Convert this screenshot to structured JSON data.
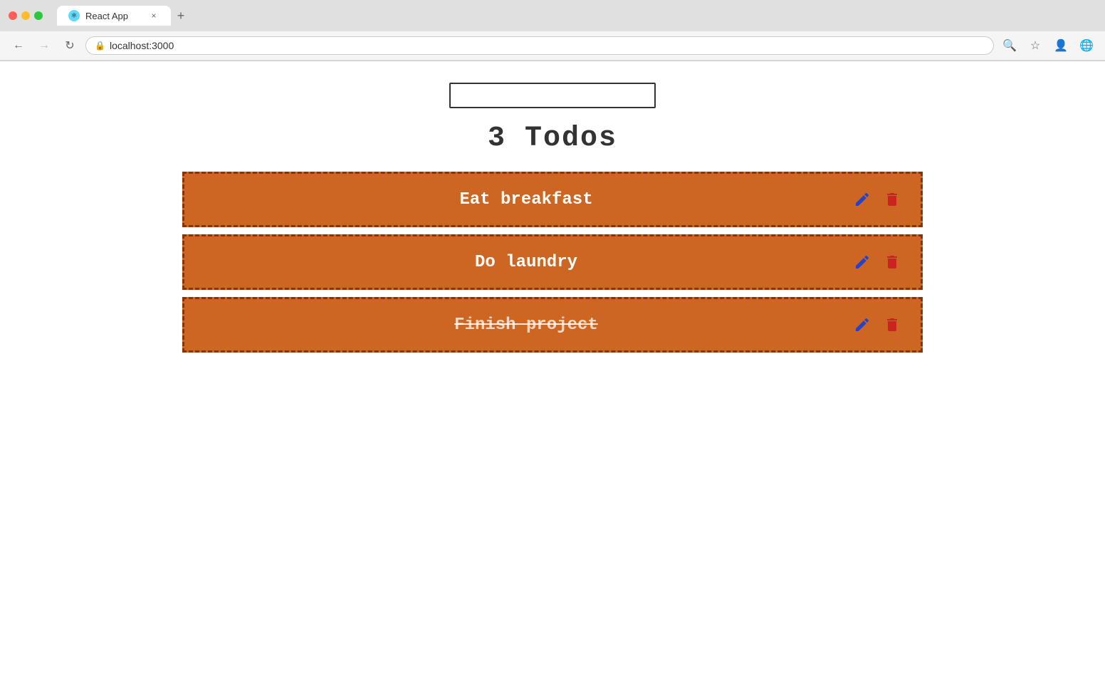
{
  "browser": {
    "tab_title": "React App",
    "address": "localhost:3000",
    "new_tab_label": "+",
    "close_tab_label": "×"
  },
  "app": {
    "input_placeholder": "",
    "todo_count_label": "3  Todos",
    "todos": [
      {
        "id": 1,
        "text": "Eat breakfast",
        "completed": false
      },
      {
        "id": 2,
        "text": "Do laundry",
        "completed": false
      },
      {
        "id": 3,
        "text": "Finish project",
        "completed": true
      }
    ]
  },
  "colors": {
    "todo_bg": "#cc6622",
    "todo_border": "#8b3300",
    "edit_icon": "#2244cc",
    "delete_icon": "#cc2222"
  }
}
